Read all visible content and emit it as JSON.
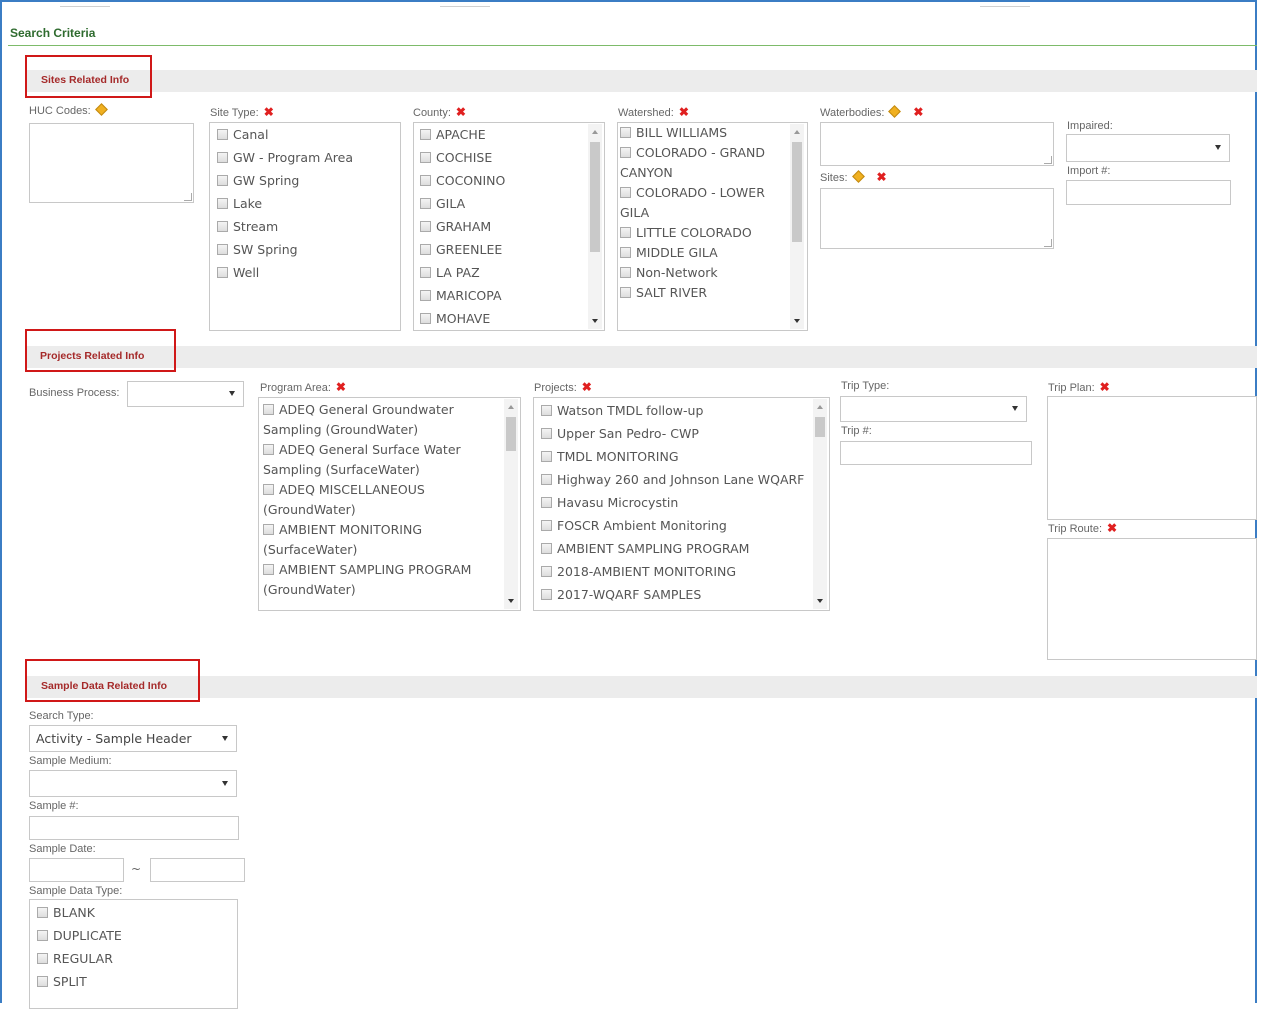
{
  "title": "Search Criteria",
  "sites": {
    "section_title": "Sites Related Info",
    "huc_label": "HUC Codes:",
    "site_type_label": "Site Type:",
    "site_types": [
      "Canal",
      "GW - Program Area",
      "GW Spring",
      "Lake",
      "Stream",
      "SW Spring",
      "Well"
    ],
    "county_label": "County:",
    "counties": [
      "APACHE",
      "COCHISE",
      "COCONINO",
      "GILA",
      "GRAHAM",
      "GREENLEE",
      "LA PAZ",
      "MARICOPA",
      "MOHAVE"
    ],
    "watershed_label": "Watershed:",
    "watersheds": [
      "BILL WILLIAMS",
      "COLORADO - GRAND CANYON",
      "COLORADO - LOWER GILA",
      "LITTLE COLORADO",
      "MIDDLE GILA",
      "Non-Network",
      "SALT RIVER"
    ],
    "waterbodies_label": "Waterbodies:",
    "sites_label": "Sites:",
    "impaired_label": "Impaired:",
    "import_label": "Import #:"
  },
  "projects": {
    "section_title": "Projects Related Info",
    "business_process_label": "Business Process:",
    "program_area_label": "Program Area:",
    "program_areas": [
      "ADEQ General Groundwater Sampling (GroundWater)",
      "ADEQ General Surface Water Sampling (SurfaceWater)",
      "ADEQ MISCELLANEOUS (GroundWater)",
      "AMBIENT MONITORING (SurfaceWater)",
      "AMBIENT SAMPLING PROGRAM (GroundWater)"
    ],
    "projects_label": "Projects:",
    "projects": [
      "Watson TMDL follow-up",
      "Upper San Pedro- CWP",
      "TMDL MONITORING",
      "Highway 260 and Johnson Lane WQARF",
      "Havasu Microcystin",
      "FOSCR Ambient Monitoring",
      "AMBIENT SAMPLING PROGRAM",
      "2018-AMBIENT MONITORING",
      "2017-WQARF SAMPLES"
    ],
    "trip_type_label": "Trip Type:",
    "trip_no_label": "Trip #:",
    "trip_plan_label": "Trip Plan:",
    "trip_route_label": "Trip Route:"
  },
  "sample": {
    "section_title": "Sample Data Related Info",
    "search_type_label": "Search Type:",
    "search_type_value": "Activity - Sample Header",
    "sample_medium_label": "Sample Medium:",
    "sample_no_label": "Sample #:",
    "sample_date_label": "Sample Date:",
    "date_sep": "~",
    "data_type_label": "Sample Data Type:",
    "data_types": [
      "BLANK",
      "DUPLICATE",
      "REGULAR",
      "SPLIT"
    ]
  },
  "colors": {
    "accent": "#3b7dc4",
    "highlight": "#d01818",
    "section_band": "#ececec",
    "title_green": "#2f6b2f"
  },
  "icons": {
    "remove": "remove-x-icon",
    "lookup": "lookup-diamond-icon"
  }
}
